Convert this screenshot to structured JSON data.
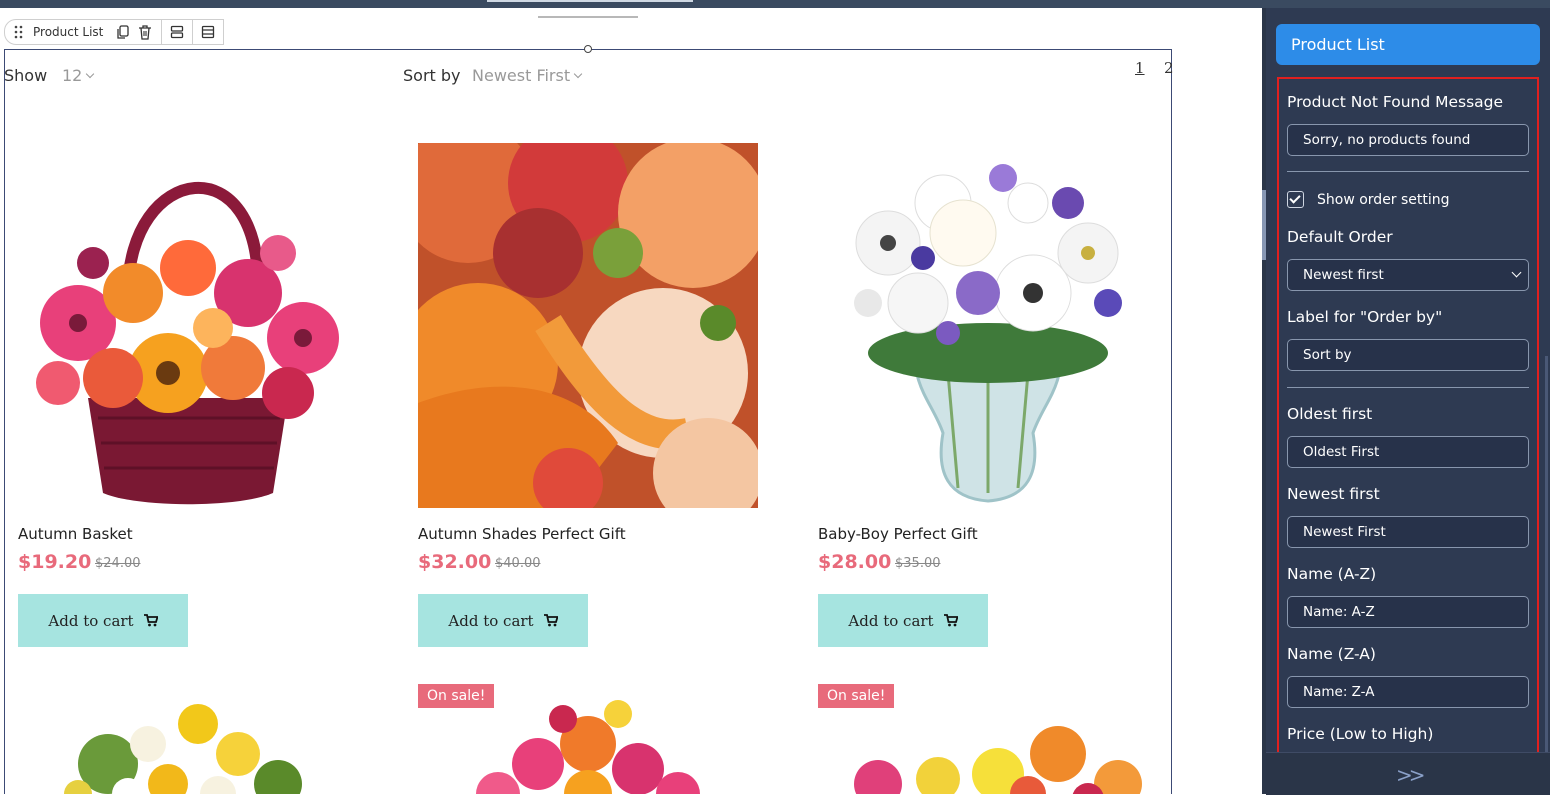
{
  "breadcrumb": {
    "label": "Product List"
  },
  "listing": {
    "show_label": "Show",
    "show_value": "12",
    "sort_label": "Sort by",
    "sort_value": "Newest First",
    "pages": [
      "1",
      "2"
    ]
  },
  "products": [
    {
      "name": "Autumn Basket",
      "price": "$19.20",
      "old_price": "$24.00",
      "button": "Add to cart"
    },
    {
      "name": "Autumn Shades Perfect Gift",
      "price": "$32.00",
      "old_price": "$40.00",
      "button": "Add to cart"
    },
    {
      "name": "Baby-Boy Perfect Gift",
      "price": "$28.00",
      "old_price": "$35.00",
      "button": "Add to cart"
    }
  ],
  "row2": {
    "sale_badge": "On sale!"
  },
  "panel": {
    "title": "Product List",
    "not_found_label": "Product Not Found Message",
    "not_found_value": "Sorry, no products found",
    "show_order_label": "Show order setting",
    "show_order_checked": true,
    "default_order_label": "Default Order",
    "default_order_value": "Newest first",
    "orderby_label": "Label for \"Order by\"",
    "orderby_value": "Sort by",
    "oldest_label": "Oldest first",
    "oldest_value": "Oldest First",
    "newest_label": "Newest first",
    "newest_value": "Newest First",
    "name_az_label": "Name (A-Z)",
    "name_az_value": "Name: A-Z",
    "name_za_label": "Name (Z-A)",
    "name_za_value": "Name: Z-A",
    "price_low_label": "Price (Low to High)",
    "expand_icon": ">>"
  },
  "colors": {
    "accent": "#2d8ce8",
    "panel_bg": "#2e3a52",
    "price": "#e86a7b",
    "cart_button": "#a6e4e0",
    "highlight": "#e1201f"
  }
}
